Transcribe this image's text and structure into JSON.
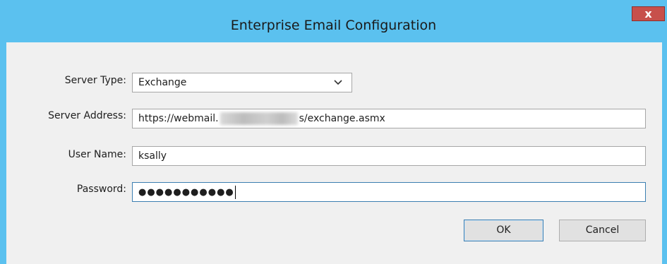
{
  "window": {
    "title": "Enterprise Email Configuration",
    "close_glyph": "x"
  },
  "form": {
    "server_type": {
      "label": "Server Type:",
      "value": "Exchange"
    },
    "server_address": {
      "label": "Server Address:",
      "value_prefix": "https://webmail.",
      "value_suffix": "s/exchange.asmx"
    },
    "user_name": {
      "label": "User Name:",
      "value": "ksally"
    },
    "password": {
      "label": "Password:",
      "masked_value": "●●●●●●●●●●●"
    }
  },
  "buttons": {
    "ok_label": "OK",
    "cancel_label": "Cancel"
  },
  "colors": {
    "title_bar": "#5bc1ef",
    "close_button": "#c7504b",
    "client_area": "#f0f0f0",
    "focus_border": "#3c7fb1"
  }
}
